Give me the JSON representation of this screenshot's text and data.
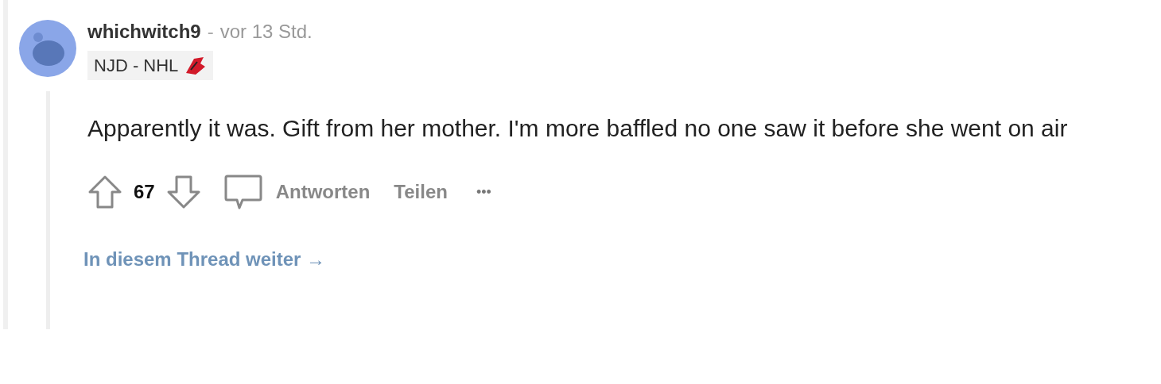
{
  "comment": {
    "author": "whichwitch9",
    "separator": "-",
    "time": "vor 13 Std.",
    "flair": "NJD - NHL",
    "body": "Apparently it was. Gift from her mother. I'm more baffled no one saw it before she went on air",
    "score": "67",
    "actions": [
      "Antworten",
      "Teilen"
    ],
    "more": "•••",
    "continue_link": "In diesem Thread weiter →"
  }
}
